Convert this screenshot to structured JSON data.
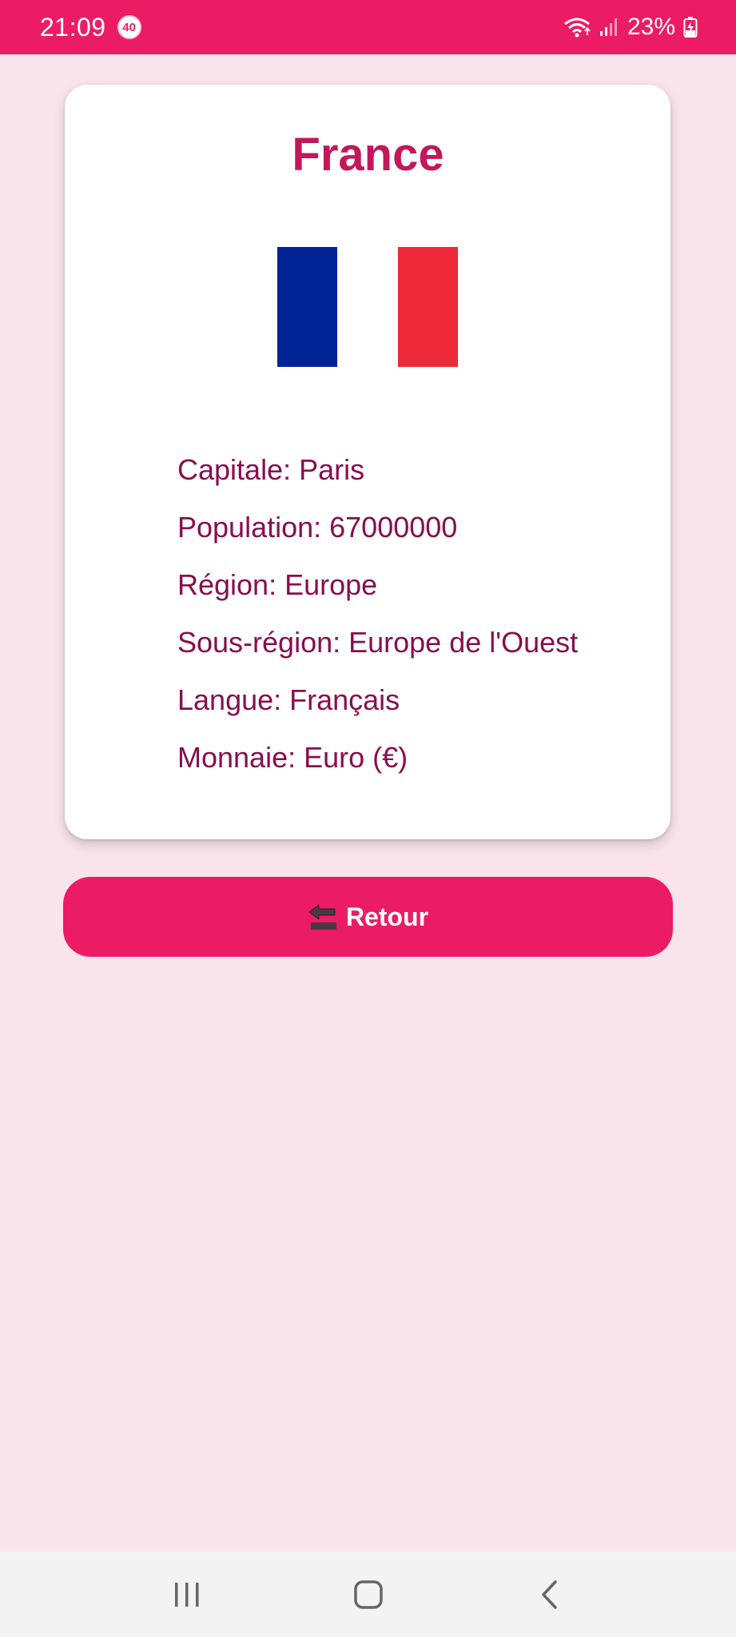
{
  "status_bar": {
    "time": "21:09",
    "notification_count": "40",
    "battery": "23%"
  },
  "country": {
    "name": "France",
    "flag_colors": [
      "#002395",
      "#FFFFFF",
      "#ED2939"
    ],
    "details": [
      "Capitale: Paris",
      "Population: 67000000",
      "Région: Europe",
      "Sous-région: Europe de l'Ouest",
      "Langue: Français",
      "Monnaie: Euro (€)"
    ]
  },
  "back_button": {
    "label": "Retour",
    "icon": "back-arrow-icon"
  },
  "nav": {
    "recents_icon": "recents-icon",
    "home_icon": "home-icon",
    "back_icon": "nav-back-icon"
  },
  "colors": {
    "primary": "#EC1C64",
    "background": "#FAE4EC",
    "title": "#C2185B",
    "text": "#880E4F"
  }
}
